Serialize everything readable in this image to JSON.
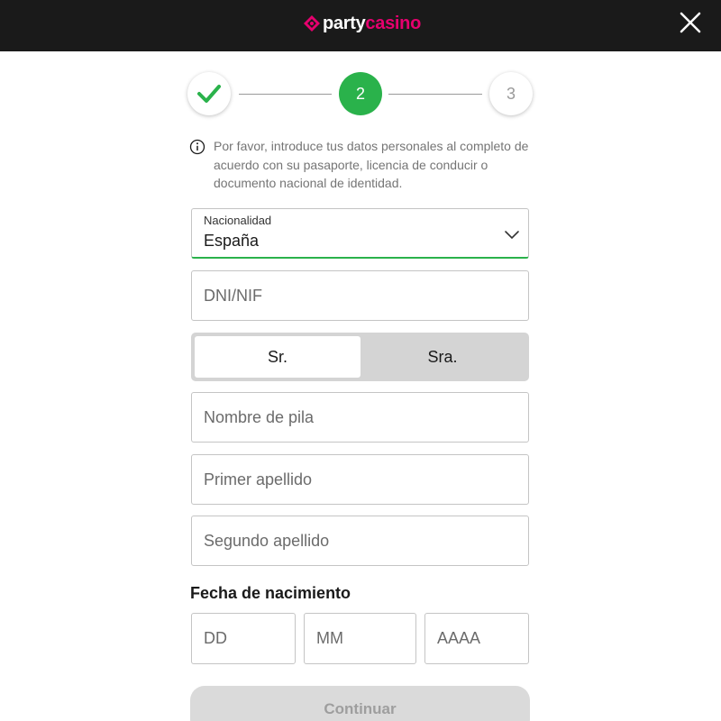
{
  "brand": {
    "logo_party": "party",
    "logo_casino": "casino",
    "accent_color": "#e6006e",
    "logo_mark_icon": "diamond-logo-icon"
  },
  "header": {
    "close_icon": "close-icon",
    "background_color": "#1a1a1a"
  },
  "stepper": {
    "steps": [
      {
        "label": "",
        "state": "completed",
        "icon": "checkmark-icon"
      },
      {
        "label": "2",
        "state": "active"
      },
      {
        "label": "3",
        "state": "pending"
      }
    ],
    "active_color": "#2ab24b"
  },
  "info": {
    "icon": "info-icon",
    "text": "Por favor, introduce tus datos personales al completo de acuerdo con su pasaporte, licencia de conducir o documento nacional de identidad."
  },
  "form": {
    "nationality": {
      "label": "Nacionalidad",
      "value": "España",
      "icon": "chevron-down-icon"
    },
    "dni": {
      "placeholder": "DNI/NIF",
      "value": ""
    },
    "gender": {
      "options": [
        "Sr.",
        "Sra."
      ],
      "selected": "Sr."
    },
    "first_name": {
      "placeholder": "Nombre de pila",
      "value": ""
    },
    "last_name_1": {
      "placeholder": "Primer apellido",
      "value": ""
    },
    "last_name_2": {
      "placeholder": "Segundo apellido",
      "value": ""
    },
    "dob": {
      "title": "Fecha de nacimiento",
      "day_placeholder": "DD",
      "month_placeholder": "MM",
      "year_placeholder": "AAAA"
    },
    "continue_label": "Continuar"
  }
}
